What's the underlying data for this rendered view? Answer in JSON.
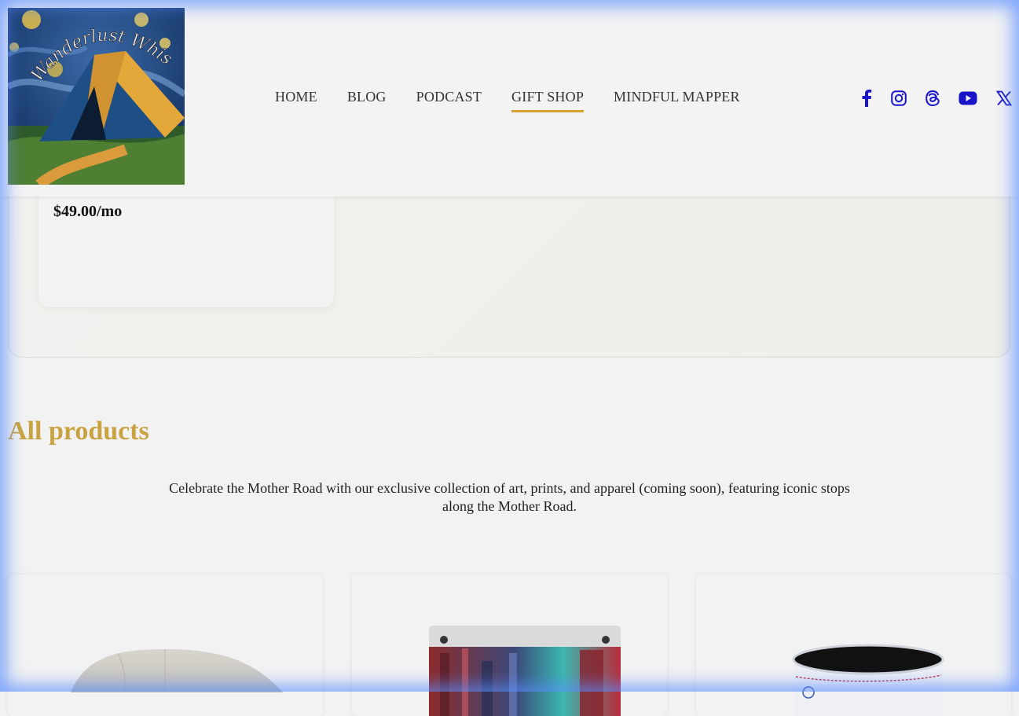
{
  "header": {
    "logo_text": "Wanderlust Whispers",
    "nav": [
      {
        "label": "HOME",
        "active": false
      },
      {
        "label": "BLOG",
        "active": false
      },
      {
        "label": "PODCAST",
        "active": false
      },
      {
        "label": "GIFT SHOP",
        "active": true
      },
      {
        "label": "MINDFUL MAPPER",
        "active": false
      }
    ],
    "social": [
      "facebook-icon",
      "instagram-icon",
      "threads-icon",
      "youtube-icon",
      "x-icon"
    ],
    "accent_color": "#d4a132",
    "social_color": "#1a14c9"
  },
  "subscription": {
    "price": "$49.00/mo"
  },
  "products_section": {
    "title": "All products",
    "title_color": "#c9a341",
    "description": "Celebrate the Mother Road with our exclusive collection of art, prints, and apparel (coming soon), featuring iconic stops along the Mother Road."
  },
  "products": [
    {
      "image": "cap-product-image"
    },
    {
      "image": "acrylic-print-product-image"
    },
    {
      "image": "mug-product-image"
    }
  ]
}
